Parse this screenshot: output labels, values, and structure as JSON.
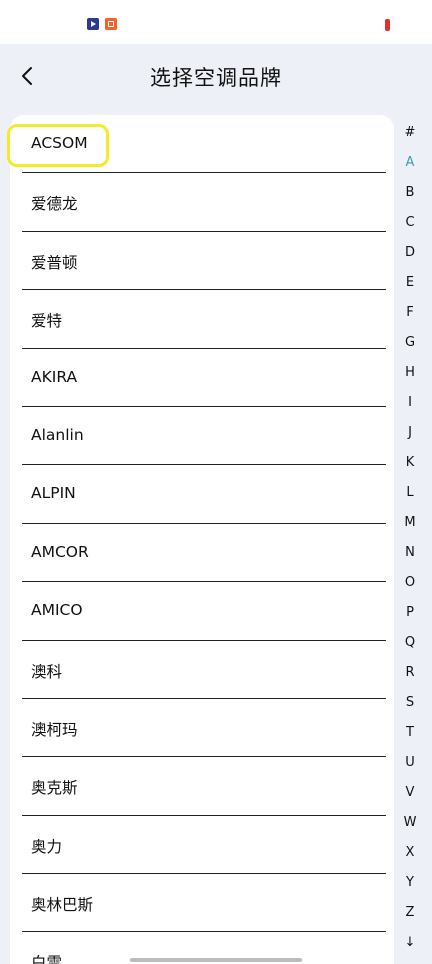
{
  "header": {
    "title": "选择空调品牌"
  },
  "brands": [
    "ACSOM",
    "爱德龙",
    "爱普顿",
    "爱特",
    "AKIRA",
    "Alanlin",
    "ALPIN",
    "AMCOR",
    "AMICO",
    "澳科",
    "澳柯玛",
    "奥克斯",
    "奥力",
    "奥林巴斯",
    "白雪"
  ],
  "index": [
    "#",
    "A",
    "B",
    "C",
    "D",
    "E",
    "F",
    "G",
    "H",
    "I",
    "J",
    "K",
    "L",
    "M",
    "N",
    "O",
    "P",
    "Q",
    "R",
    "S",
    "T",
    "U",
    "V",
    "W",
    "X",
    "Y",
    "Z",
    "↓"
  ],
  "active_index": "A",
  "colors": {
    "active_index": "#3aa0a8",
    "highlight": "#f2ea2a",
    "background": "#eef0f7"
  }
}
